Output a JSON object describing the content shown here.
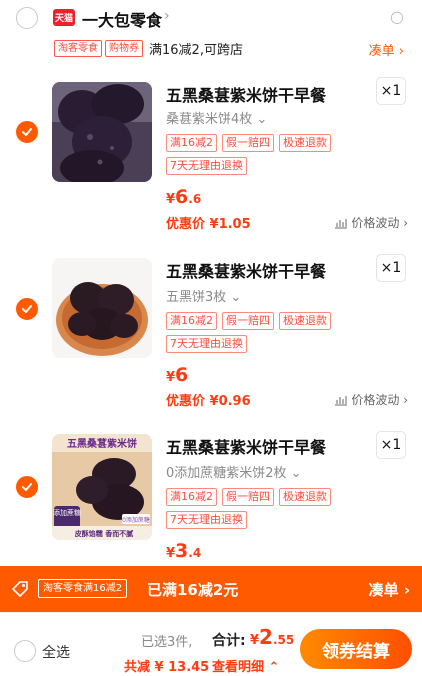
{
  "shop": {
    "badge": "天猫",
    "name": "一大包零食",
    "arrow": "›",
    "more": "○",
    "promo_tags": [
      "淘客零食",
      "购物券"
    ],
    "promo_text": "满16减2,可跨店",
    "promo_link": "凑单 ›"
  },
  "items": [
    {
      "title": "五黑桑葚紫米饼干早餐",
      "qty": "×1",
      "sku": "桑葚紫米饼4枚 ⌄",
      "tags": [
        "满16减2",
        "假一赔四",
        "极速退款",
        "7天无理由退换"
      ],
      "price_currency": "¥",
      "price_int": "6",
      "price_dec": ".6",
      "discount": "优惠价 ¥1.05",
      "trend": "价格波动 ›"
    },
    {
      "title": "五黑桑葚紫米饼干早餐",
      "qty": "×1",
      "sku": "五黑饼3枚 ⌄",
      "tags": [
        "满16减2",
        "假一赔四",
        "极速退款",
        "7天无理由退换"
      ],
      "price_currency": "¥",
      "price_int": "6",
      "price_dec": "",
      "discount": "优惠价 ¥0.96",
      "trend": "价格波动 ›"
    },
    {
      "title": "五黑桑葚紫米饼干早餐",
      "qty": "×1",
      "sku": "0添加蔗糖紫米饼2枚 ⌄",
      "tags": [
        "满16减2",
        "假一赔四",
        "极速退款",
        "7天无理由退换"
      ],
      "price_currency": "¥",
      "price_int": "3",
      "price_dec": ".4",
      "discount": "",
      "trend": "",
      "thumb_text": {
        "banner": "五黑桑葚紫米饼",
        "left": "添加蔗糖",
        "bottom": "皮酥馅糯 香而不腻",
        "badge": "0添加蔗糖"
      }
    }
  ],
  "promo_bar": {
    "tag": "淘客零食满16减2",
    "text": "已满16减2元",
    "link": "凑单 ›"
  },
  "footer": {
    "select_all": "全选",
    "selected": "已选3件,",
    "total_label": "合计:",
    "total_currency": "¥",
    "total_int": "2",
    "total_dec": ".55",
    "saving": "共减 ¥ 13.45",
    "detail": "查看明细 ⌃",
    "checkout": "领券结算"
  },
  "colors": {
    "accent": "#ff5a00",
    "price": "#ff3b10",
    "tmall": "#e8232d"
  }
}
